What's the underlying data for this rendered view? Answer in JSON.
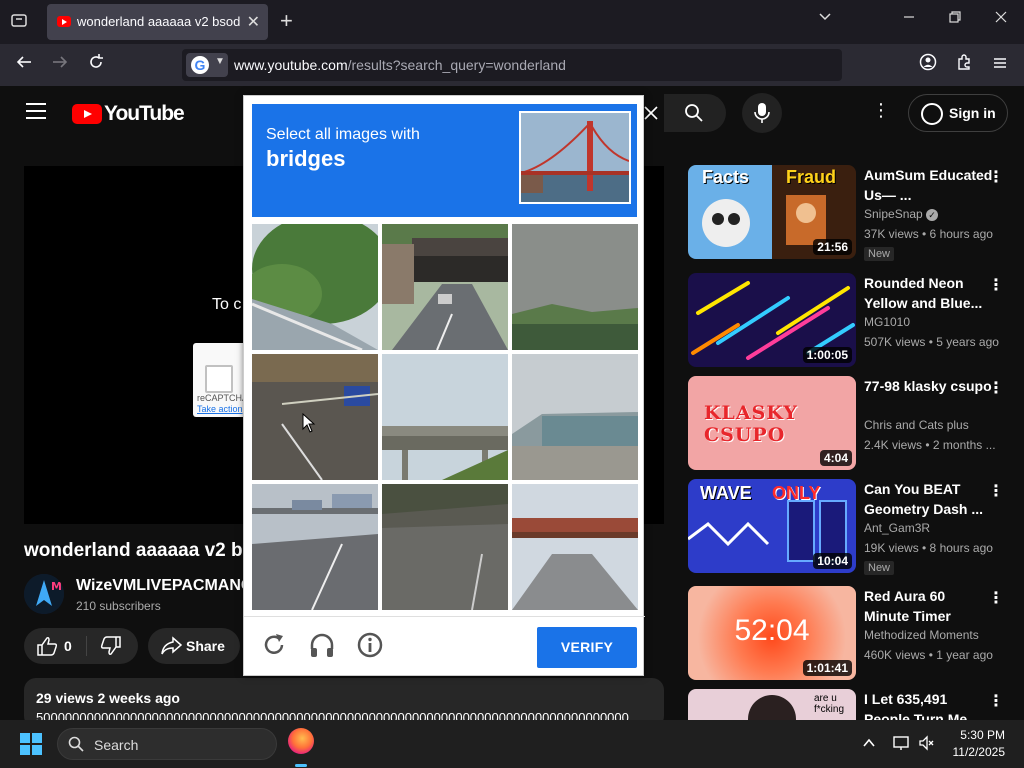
{
  "browser": {
    "tab_title": "wonderland aaaaaa v2 bsod - YouTube",
    "url_domain": "www.youtube.com",
    "url_path": "/results?search_query=wonderland"
  },
  "youtube": {
    "logo_text": "YouTube",
    "sign_in": "Sign in",
    "player_partial_text": "To c",
    "recaptcha_box": {
      "brand": "reCAPTCHA",
      "action": "Take action"
    },
    "video_title": "wonderland aaaaaa v2 b",
    "channel_name": "WizeVMLIVEPACMANC",
    "subscribers": "210 subscribers",
    "likes": "0",
    "share_label": "Share",
    "description_meta": "29 views  2 weeks ago",
    "description_text": "5000000000000000000000000000000000000000000000000000000000000000000000000000000000"
  },
  "recommendations": [
    {
      "title": "AumSum Educated Us— ...",
      "channel": "SnipeSnap",
      "verified": true,
      "meta": "37K views • 6 hours ago",
      "badge": "New",
      "duration": "21:56",
      "thumb_text_left": "Facts",
      "thumb_text_right": "Fraud"
    },
    {
      "title": "Rounded Neon Yellow and Blue...",
      "channel": "MG1010",
      "meta": "507K views • 5 years ago",
      "duration": "1:00:05"
    },
    {
      "title": "77-98 klasky csupo",
      "channel": "Chris and Cats plus",
      "meta": "2.4K views • 2 months ...",
      "duration": "4:04",
      "thumb_text": "KLASKY CSUPO"
    },
    {
      "title": "Can You BEAT Geometry Dash ...",
      "channel": "Ant_Gam3R",
      "meta": "19K views • 8 hours ago",
      "badge": "New",
      "duration": "10:04",
      "thumb_text_left": "WAVE",
      "thumb_text_right": "ONLY"
    },
    {
      "title": "Red Aura 60 Minute Timer",
      "channel": "Methodized Moments",
      "meta": "460K views • 1 year ago",
      "duration": "1:01:41",
      "thumb_text": "52:04"
    },
    {
      "title": "I Let 635,491 People Turn Me...",
      "channel": "",
      "meta": "",
      "thumb_text": "are u f*cking"
    }
  ],
  "captcha": {
    "instruction": "Select all images with",
    "target": "bridges",
    "verify_label": "VERIFY"
  },
  "taskbar": {
    "search_label": "Search",
    "time": "5:30 PM",
    "date": "11/2/2025"
  },
  "colors": {
    "captcha_blue": "#1a73e8",
    "yt_red": "#ff0000",
    "yt_bg": "#0f0f0f"
  }
}
